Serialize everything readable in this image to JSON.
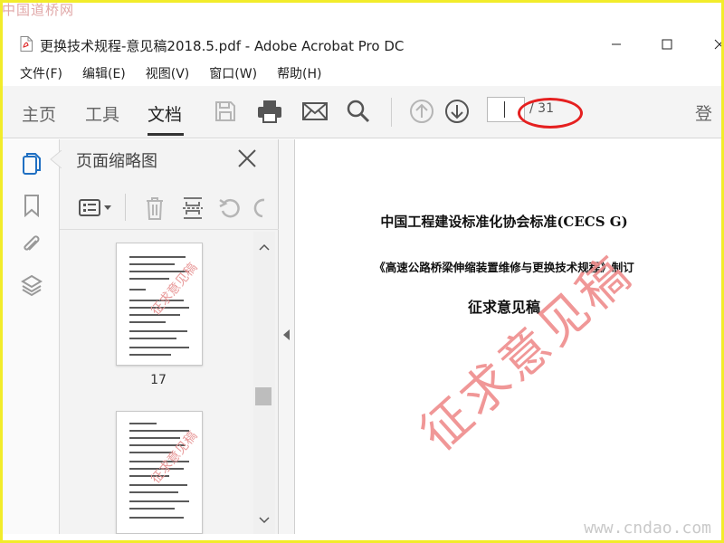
{
  "watermark": {
    "site_cn": "中国道桥网",
    "site_url": "www.cndao.com"
  },
  "window": {
    "title": "更换技术规程-意见稿2018.5.pdf - Adobe Acrobat Pro DC"
  },
  "menu": [
    "文件(F)",
    "编辑(E)",
    "视图(V)",
    "窗口(W)",
    "帮助(H)"
  ],
  "toolbar": {
    "tabs": [
      "主页",
      "工具",
      "文档"
    ],
    "active_tab": "文档",
    "page_input": {
      "value": ""
    },
    "page_total": "/ 31",
    "login": "登"
  },
  "panel": {
    "title": "页面缩略图",
    "thumbnails": [
      {
        "page": "17",
        "stamp": "征求意见稿"
      },
      {
        "page": "",
        "stamp": "征求意见稿"
      }
    ]
  },
  "document": {
    "heading": "中国工程建设标准化协会标准(CECS G)",
    "subheading": "《高速公路桥梁伸缩装置维修与更换技术规程》制订",
    "draft_label": "征求意见稿",
    "stamp": "征求意见稿"
  },
  "colors": {
    "highlight_ellipse": "#e52020",
    "frame": "#f2ec2a",
    "stamp": "#ef8c8c"
  }
}
